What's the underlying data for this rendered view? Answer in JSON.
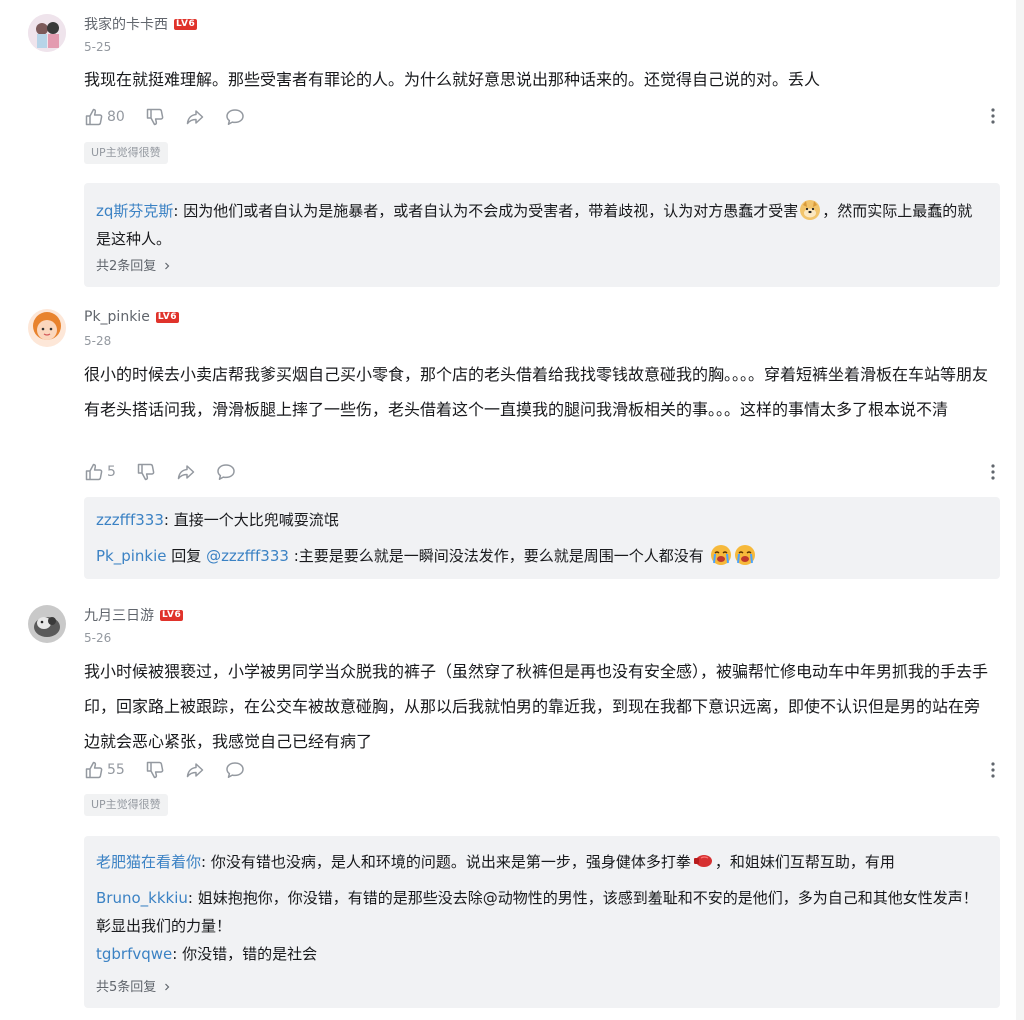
{
  "comments": [
    {
      "username": "我家的卡卡西",
      "level": "LV6",
      "date": "5-25",
      "text": "我现在就挺难理解。那些受害者有罪论的人。为什么就好意思说出那种话来的。还觉得自己说的对。丢人",
      "likes": "80",
      "up_badge": "UP主觉得很赞",
      "replies": [
        {
          "user": "zq斯芬克斯",
          "text_a": ": 因为他们或者自认为是施暴者，或者自认为不会成为受害者，带着歧视，认为对方愚蠢才受害",
          "text_b": "，然而实际上最蠢的就是这种人。"
        }
      ],
      "view_more": "共2条回复"
    },
    {
      "username": "Pk_pinkie",
      "level": "LV6",
      "date": "5-28",
      "text": "很小的时候去小卖店帮我爹买烟自己买小零食，那个店的老头借着给我找零钱故意碰我的胸。。。。穿着短裤坐着滑板在车站等朋友有老头搭话问我，滑滑板腿上摔了一些伤，老头借着这个一直摸我的腿问我滑板相关的事。。。这样的事情太多了根本说不清",
      "likes": "5",
      "replies": [
        {
          "user": "zzzfff333",
          "text": ": 直接一个大比兜喊耍流氓"
        },
        {
          "user": "Pk_pinkie",
          "reply_word": " 回复 ",
          "mention": "@zzzfff333",
          "text": " :主要是要么就是一瞬间没法发作，要么就是周围一个人都没有"
        }
      ]
    },
    {
      "username": "九月三日游",
      "level": "LV6",
      "date": "5-26",
      "text": "我小时候被猥亵过，小学被男同学当众脱我的裤子（虽然穿了秋裤但是再也没有安全感），被骗帮忙修电动车中年男抓我的手去手印，回家路上被跟踪，在公交车被故意碰胸，从那以后我就怕男的靠近我，到现在我都下意识远离，即使不认识但是男的站在旁边就会恶心紧张，我感觉自己已经有病了",
      "likes": "55",
      "up_badge": "UP主觉得很赞",
      "replies": [
        {
          "user": "老肥猫在看着你",
          "text_a": ": 你没有错也没病，是人和环境的问题。说出来是第一步，强身健体多打拳",
          "text_b": "，和姐妹们互帮互助，有用"
        },
        {
          "user": "Bruno_kkkiu",
          "text": ": 姐妹抱抱你，你没错，有错的是那些没去除@动物性的男性，该感到羞耻和不安的是他们，多为自己和其他女性发声！彰显出我们的力量！"
        },
        {
          "user": "tgbrfvqwe",
          "text": ": 你没错，错的是社会"
        }
      ],
      "view_more": "共5条回复"
    }
  ],
  "icons": {
    "like": "thumbs-up-icon",
    "dislike": "thumbs-down-icon",
    "share": "share-icon",
    "reply": "comment-bubble-icon",
    "more": "more-vertical-icon",
    "chevron": "chevron-right-icon",
    "emoji_doge": "doge-emoji-icon",
    "emoji_cry": "crying-emoji-icon",
    "emoji_glove": "boxing-glove-emoji-icon"
  },
  "colors": {
    "username_link": "#3b82c4",
    "level_badge": "#e0332b",
    "reply_background": "#f1f2f4",
    "meta_text": "#9499a0"
  }
}
